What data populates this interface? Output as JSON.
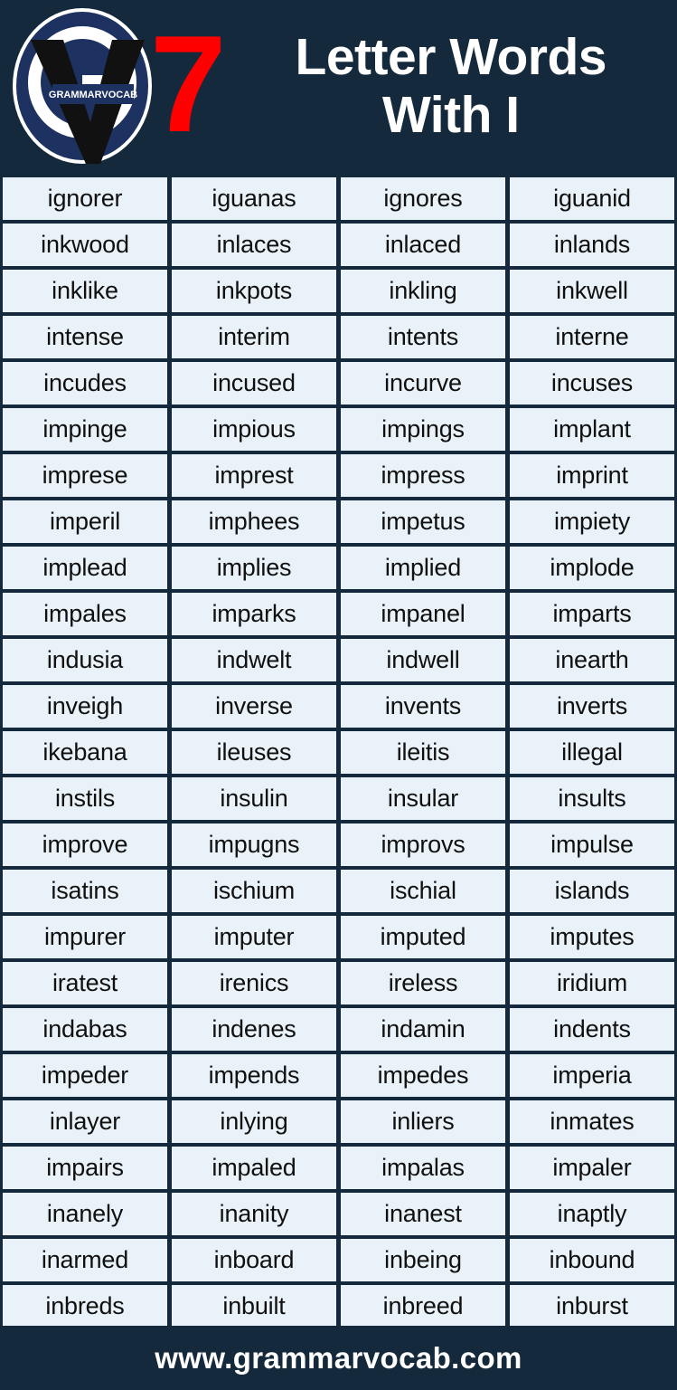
{
  "theme": {
    "background": "#15293c",
    "cell_background": "#e8f2f8",
    "cell_text": "#101010",
    "accent_red": "#ff0000",
    "title_text": "#ffffff",
    "logo_blue": "#1d3260"
  },
  "header": {
    "number": "7",
    "title_line_1": "Letter Words",
    "title_line_2": "With I",
    "logo": {
      "brand_label": "GRAMMARVOCAB"
    }
  },
  "grid": {
    "columns": 4,
    "rows": 25,
    "words": [
      [
        "ignorer",
        "iguanas",
        "ignores",
        "iguanid"
      ],
      [
        "inkwood",
        "inlaces",
        "inlaced",
        "inlands"
      ],
      [
        "inklike",
        "inkpots",
        "inkling",
        "inkwell"
      ],
      [
        "intense",
        "interim",
        "intents",
        "interne"
      ],
      [
        "incudes",
        "incused",
        "incurve",
        "incuses"
      ],
      [
        "impinge",
        "impious",
        "impings",
        "implant"
      ],
      [
        "imprese",
        "imprest",
        "impress",
        "imprint"
      ],
      [
        "imperil",
        "imphees",
        "impetus",
        "impiety"
      ],
      [
        "implead",
        "implies",
        "implied",
        "implode"
      ],
      [
        "impales",
        "imparks",
        "impanel",
        "imparts"
      ],
      [
        "indusia",
        "indwelt",
        "indwell",
        "inearth"
      ],
      [
        "inveigh",
        "inverse",
        "invents",
        "inverts"
      ],
      [
        "ikebana",
        "ileuses",
        "ileitis",
        "illegal"
      ],
      [
        "instils",
        "insulin",
        "insular",
        "insults"
      ],
      [
        "improve",
        "impugns",
        "improvs",
        "impulse"
      ],
      [
        "isatins",
        "ischium",
        "ischial",
        "islands"
      ],
      [
        "impurer",
        "imputer",
        "imputed",
        "imputes"
      ],
      [
        "iratest",
        "irenics",
        "ireless",
        "iridium"
      ],
      [
        "indabas",
        "indenes",
        "indamin",
        "indents"
      ],
      [
        "impeder",
        "impends",
        "impedes",
        "imperia"
      ],
      [
        "inlayer",
        "inlying",
        "inliers",
        "inmates"
      ],
      [
        "impairs",
        "impaled",
        "impalas",
        "impaler"
      ],
      [
        "inanely",
        "inanity",
        "inanest",
        "inaptly"
      ],
      [
        "inarmed",
        "inboard",
        "inbeing",
        "inbound"
      ],
      [
        "inbreds",
        "inbuilt",
        "inbreed",
        "inburst"
      ]
    ]
  },
  "footer": {
    "website": "www.grammarvocab.com"
  }
}
